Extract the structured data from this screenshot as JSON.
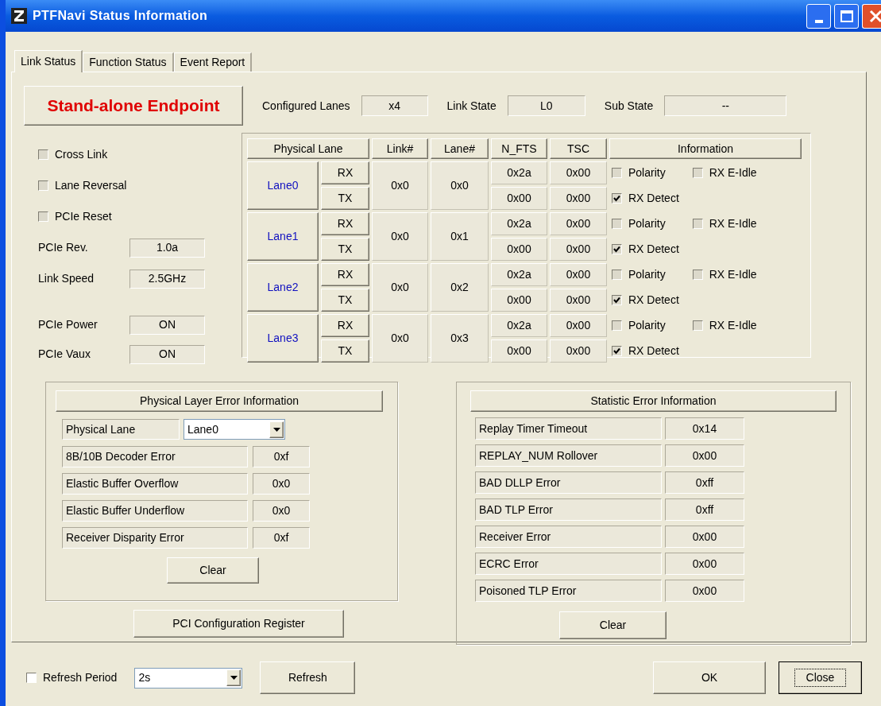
{
  "window": {
    "title": "PTFNavi Status Information"
  },
  "tabs": [
    {
      "label": "Link Status",
      "selected": true
    },
    {
      "label": "Function Status",
      "selected": false
    },
    {
      "label": "Event Report",
      "selected": false
    }
  ],
  "endpoint_button": "Stand-alone Endpoint",
  "link_fields": [
    {
      "label": "Configured Lanes",
      "value": "x4"
    },
    {
      "label": "Link State",
      "value": "L0"
    },
    {
      "label": "Sub State",
      "value": "--"
    }
  ],
  "options": [
    {
      "label": "Cross Link",
      "checked": false
    },
    {
      "label": "Lane Reversal",
      "checked": false
    },
    {
      "label": "PCIe Reset",
      "checked": false
    }
  ],
  "speed_info": [
    {
      "label": "PCIe Rev.",
      "value": "1.0a"
    },
    {
      "label": "Link Speed",
      "value": "2.5GHz"
    }
  ],
  "power_info": [
    {
      "label": "PCIe Power",
      "value": "ON"
    },
    {
      "label": "PCIe Vaux",
      "value": "ON"
    }
  ],
  "lane_table": {
    "columns": [
      "Physical Lane",
      "Link#",
      "Lane#",
      "N_FTS",
      "TSC",
      "Information"
    ],
    "lanes": [
      {
        "name": "Lane0",
        "link": "0x0",
        "lane": "0x0",
        "rx": {
          "dir": "RX",
          "n_fts": "0x2a",
          "tsc": "0x00"
        },
        "tx": {
          "dir": "TX",
          "n_fts": "0x00",
          "tsc": "0x00"
        },
        "polarity": {
          "label": "Polarity",
          "checked": false
        },
        "rx_eidle": {
          "label": "RX E-Idle",
          "checked": false
        },
        "rx_detect": {
          "label": "RX Detect",
          "checked": true
        }
      },
      {
        "name": "Lane1",
        "link": "0x0",
        "lane": "0x1",
        "rx": {
          "dir": "RX",
          "n_fts": "0x2a",
          "tsc": "0x00"
        },
        "tx": {
          "dir": "TX",
          "n_fts": "0x00",
          "tsc": "0x00"
        },
        "polarity": {
          "label": "Polarity",
          "checked": false
        },
        "rx_eidle": {
          "label": "RX E-Idle",
          "checked": false
        },
        "rx_detect": {
          "label": "RX Detect",
          "checked": true
        }
      },
      {
        "name": "Lane2",
        "link": "0x0",
        "lane": "0x2",
        "rx": {
          "dir": "RX",
          "n_fts": "0x2a",
          "tsc": "0x00"
        },
        "tx": {
          "dir": "TX",
          "n_fts": "0x00",
          "tsc": "0x00"
        },
        "polarity": {
          "label": "Polarity",
          "checked": false
        },
        "rx_eidle": {
          "label": "RX E-Idle",
          "checked": false
        },
        "rx_detect": {
          "label": "RX Detect",
          "checked": true
        }
      },
      {
        "name": "Lane3",
        "link": "0x0",
        "lane": "0x3",
        "rx": {
          "dir": "RX",
          "n_fts": "0x2a",
          "tsc": "0x00"
        },
        "tx": {
          "dir": "TX",
          "n_fts": "0x00",
          "tsc": "0x00"
        },
        "polarity": {
          "label": "Polarity",
          "checked": false
        },
        "rx_eidle": {
          "label": "RX E-Idle",
          "checked": false
        },
        "rx_detect": {
          "label": "RX Detect",
          "checked": true
        }
      }
    ]
  },
  "physical_error": {
    "title": "Physical Layer Error Information",
    "lane_select": {
      "label": "Physical Lane",
      "value": "Lane0"
    },
    "rows": [
      {
        "label": "8B/10B Decoder Error",
        "value": "0xf"
      },
      {
        "label": "Elastic Buffer Overflow",
        "value": "0x0"
      },
      {
        "label": "Elastic Buffer Underflow",
        "value": "0x0"
      },
      {
        "label": "Receiver Disparity Error",
        "value": "0xf"
      }
    ],
    "clear": "Clear"
  },
  "pci_config_button": "PCI Configuration Register",
  "statistic_error": {
    "title": "Statistic Error Information",
    "rows": [
      {
        "label": "Replay Timer Timeout",
        "value": "0x14"
      },
      {
        "label": "REPLAY_NUM Rollover",
        "value": "0x00"
      },
      {
        "label": "BAD DLLP Error",
        "value": "0xff"
      },
      {
        "label": "BAD TLP Error",
        "value": "0xff"
      },
      {
        "label": "Receiver Error",
        "value": "0x00"
      },
      {
        "label": "ECRC Error",
        "value": "0x00"
      },
      {
        "label": "Poisoned TLP Error",
        "value": "0x00"
      }
    ],
    "clear": "Clear"
  },
  "footer": {
    "refresh_period": {
      "label": "Refresh Period",
      "checked": false
    },
    "period": {
      "value": "2s"
    },
    "refresh_button": "Refresh",
    "ok_button": "OK",
    "close_button": "Close"
  }
}
